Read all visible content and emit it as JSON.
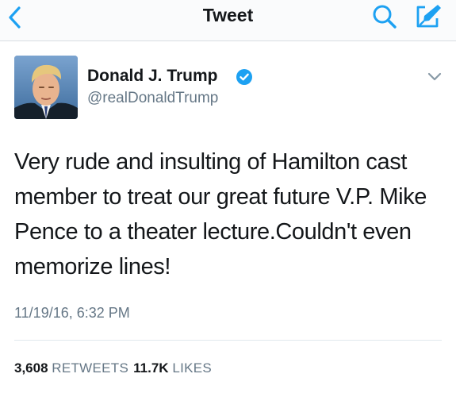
{
  "nav": {
    "title": "Tweet",
    "back_icon": "chevron-left-icon",
    "search_icon": "search-icon",
    "compose_icon": "compose-icon"
  },
  "tweet": {
    "author_name": "Donald J. Trump",
    "author_handle": "@realDonaldTrump",
    "verified_icon": "verified-badge-icon",
    "text": "Very rude and insulting of Hamilton cast member to treat our great future V.P. Mike Pence to a theater lecture.Couldn't even memorize lines!",
    "timestamp": "11/19/16, 6:32 PM",
    "retweets_count": "3,608",
    "retweets_label": "RETWEETS",
    "likes_count": "11.7K",
    "likes_label": "LIKES"
  },
  "colors": {
    "accent": "#1da1f2",
    "text_primary": "#14171a",
    "text_secondary": "#657786"
  }
}
